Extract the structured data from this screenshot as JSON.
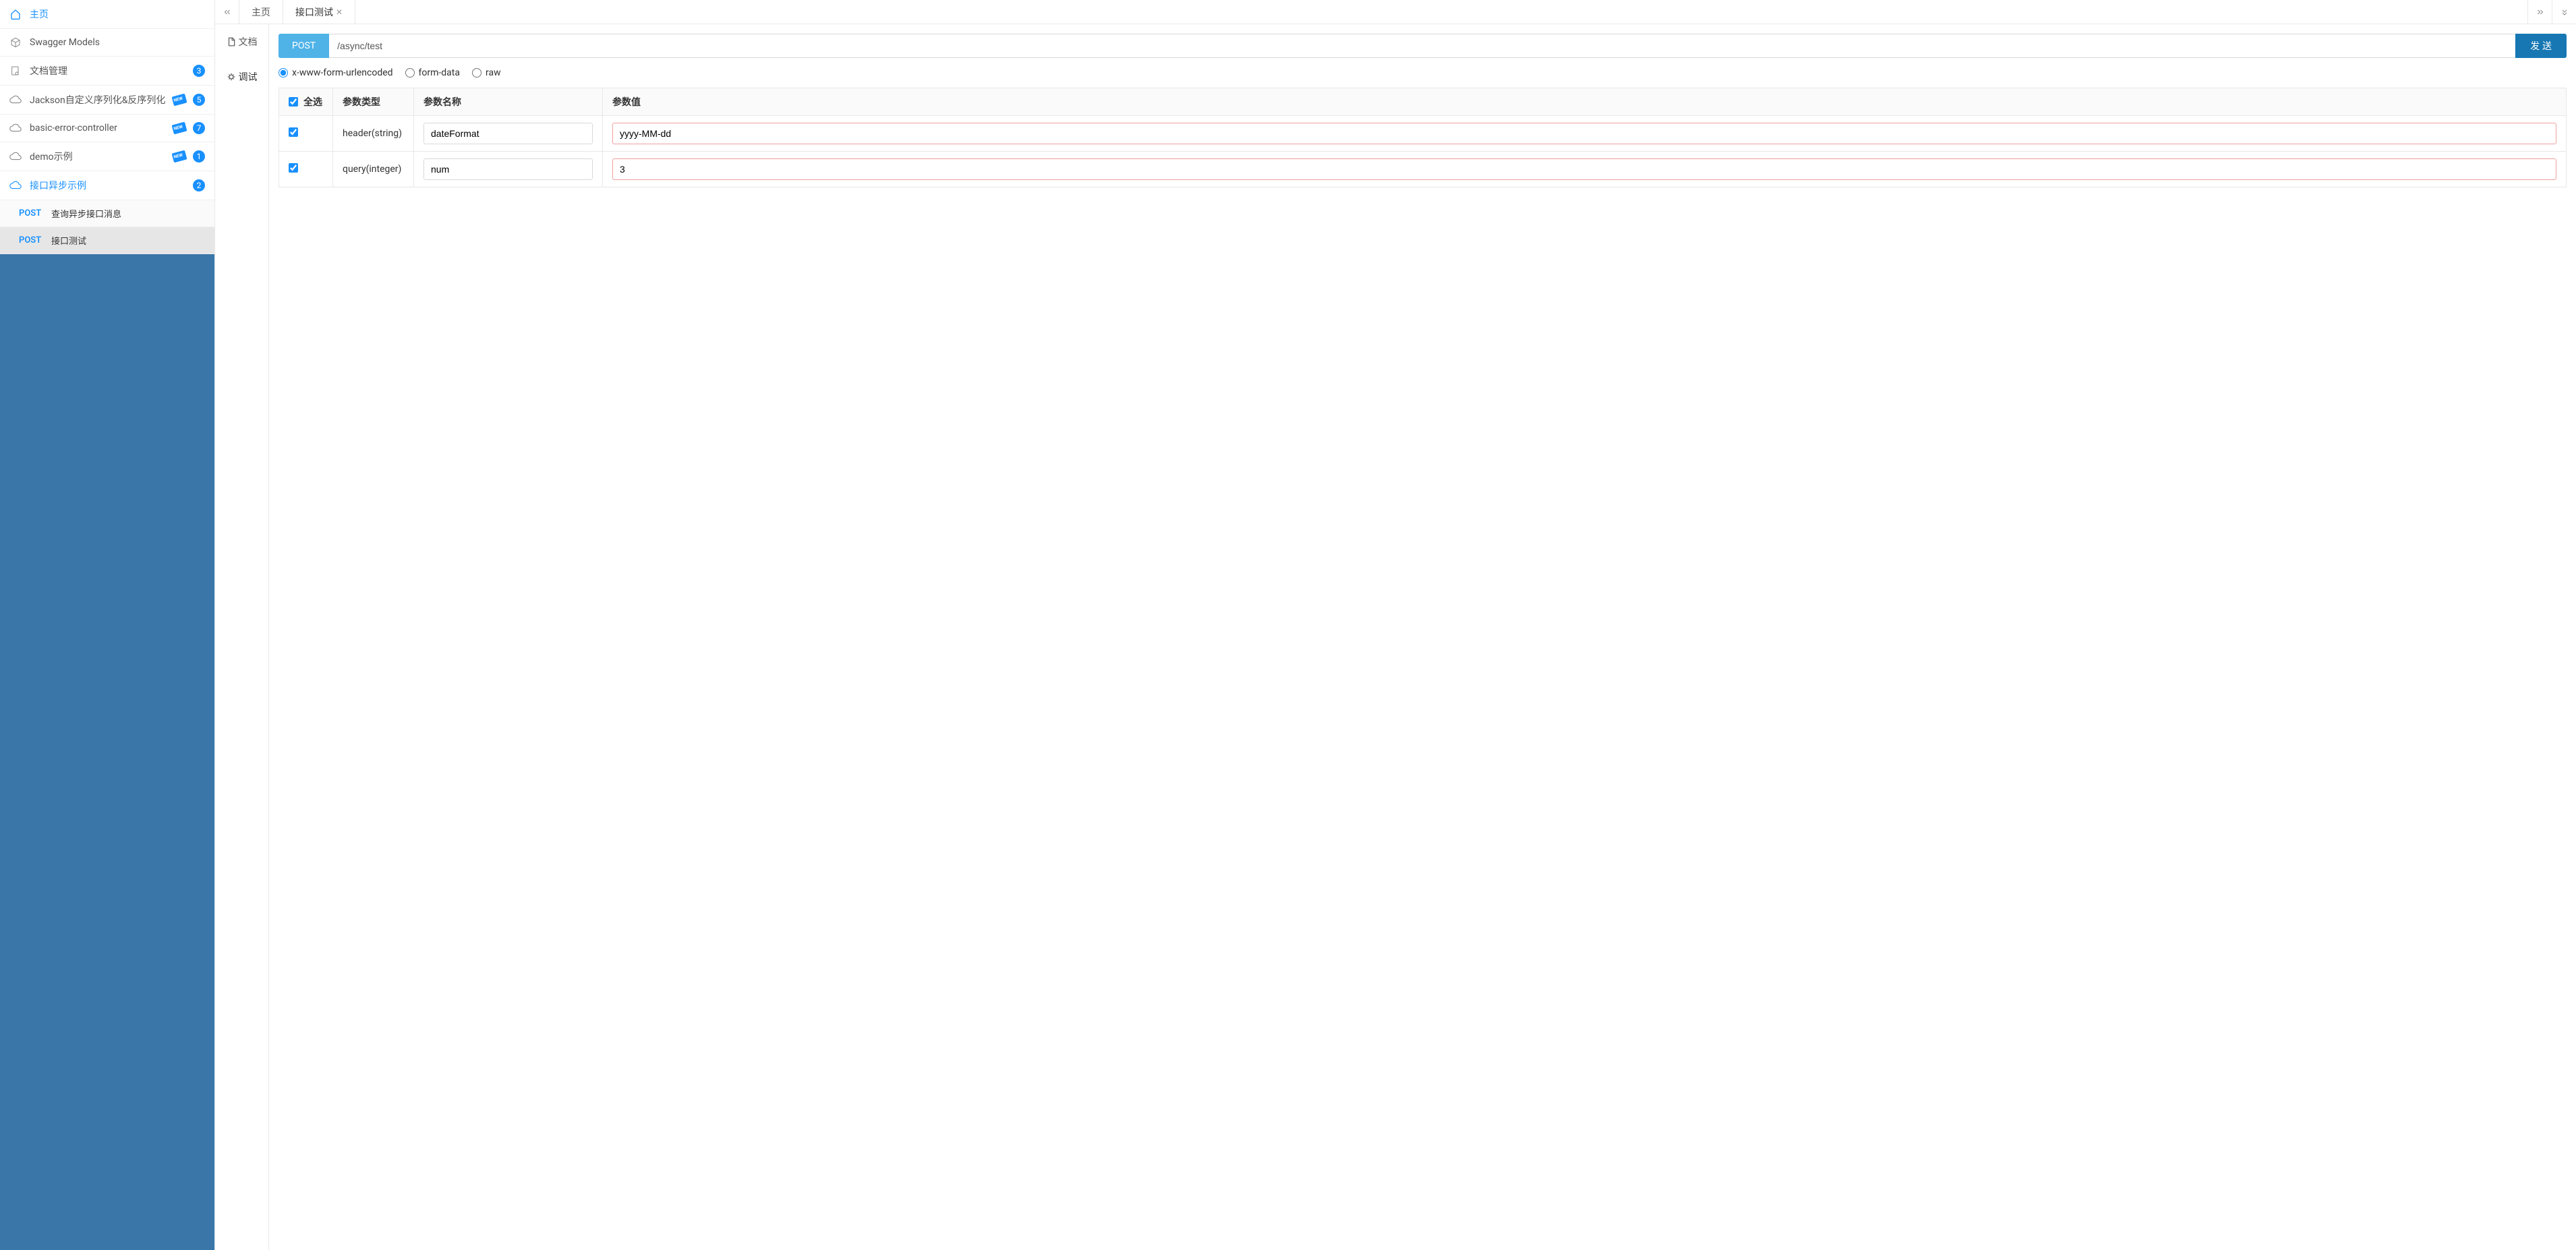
{
  "sidebar": {
    "items": [
      {
        "label": "主页",
        "icon": "home-icon",
        "active": true
      },
      {
        "label": "Swagger Models",
        "icon": "cube-icon"
      },
      {
        "label": "文档管理",
        "icon": "doc-settings-icon",
        "badge": "3"
      },
      {
        "label": "Jackson自定义序列化&反序列化",
        "icon": "cloud-icon",
        "new": true,
        "badge": "5"
      },
      {
        "label": "basic-error-controller",
        "icon": "cloud-icon",
        "new": true,
        "badge": "7"
      },
      {
        "label": "demo示例",
        "icon": "cloud-icon",
        "new": true,
        "badge": "1"
      },
      {
        "label": "接口异步示例",
        "icon": "cloud-icon",
        "badge": "2",
        "active": true
      }
    ],
    "sub": [
      {
        "method": "POST",
        "name": "查询异步接口消息"
      },
      {
        "method": "POST",
        "name": "接口测试",
        "selected": true
      }
    ]
  },
  "tabs": {
    "items": [
      {
        "label": "主页"
      },
      {
        "label": "接口测试",
        "closable": true,
        "active": true
      }
    ]
  },
  "sideTabs": {
    "doc": "文档",
    "debug": "调试"
  },
  "request": {
    "method": "POST",
    "url": "/async/test",
    "send": "发 送"
  },
  "bodyTypes": {
    "urlencoded": "x-www-form-urlencoded",
    "formdata": "form-data",
    "raw": "raw",
    "selected": "urlencoded"
  },
  "paramsTable": {
    "selectAll": "全选",
    "colType": "参数类型",
    "colName": "参数名称",
    "colValue": "参数值",
    "rows": [
      {
        "checked": true,
        "type": "header(string)",
        "name": "dateFormat",
        "value": "yyyy-MM-dd"
      },
      {
        "checked": true,
        "type": "query(integer)",
        "name": "num",
        "value": "3"
      }
    ]
  }
}
